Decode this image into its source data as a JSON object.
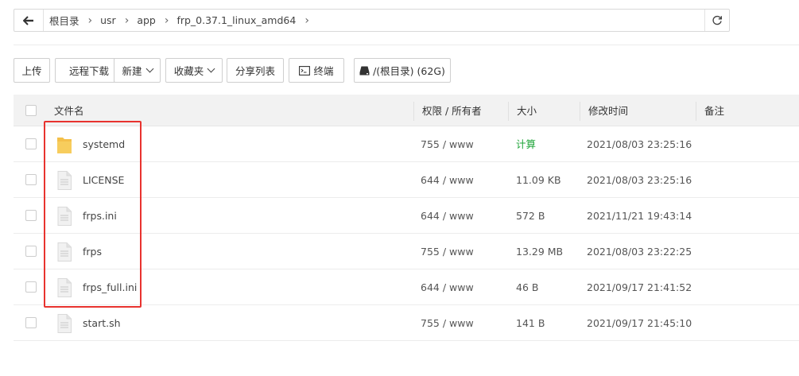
{
  "breadcrumb": {
    "items": [
      "根目录",
      "usr",
      "app",
      "frp_0.37.1_linux_amd64"
    ]
  },
  "toolbar": {
    "upload": "上传",
    "remote_download": "远程下载",
    "new": "新建",
    "favorites": "收藏夹",
    "share_list": "分享列表",
    "terminal": "终端",
    "disk": "/(根目录) (62G)"
  },
  "table": {
    "headers": {
      "name": "文件名",
      "perm": "权限 / 所有者",
      "size": "大小",
      "mtime": "修改时间",
      "note": "备注"
    },
    "rows": [
      {
        "type": "folder",
        "name": "systemd",
        "perm": "755 / www",
        "size": "计算",
        "mtime": "2021/08/03 23:25:16"
      },
      {
        "type": "file",
        "name": "LICENSE",
        "perm": "644 / www",
        "size": "11.09 KB",
        "mtime": "2021/08/03 23:25:16"
      },
      {
        "type": "file",
        "name": "frps.ini",
        "perm": "644 / www",
        "size": "572 B",
        "mtime": "2021/11/21 19:43:14"
      },
      {
        "type": "file",
        "name": "frps",
        "perm": "755 / www",
        "size": "13.29 MB",
        "mtime": "2021/08/03 23:22:25"
      },
      {
        "type": "file",
        "name": "frps_full.ini",
        "perm": "644 / www",
        "size": "46 B",
        "mtime": "2021/09/17 21:41:52"
      },
      {
        "type": "file",
        "name": "start.sh",
        "perm": "755 / www",
        "size": "141 B",
        "mtime": "2021/09/17 21:45:10"
      }
    ]
  },
  "colors": {
    "highlight": "#e8332f",
    "calc_link": "#20a53a",
    "folder": "#f4c04a"
  }
}
